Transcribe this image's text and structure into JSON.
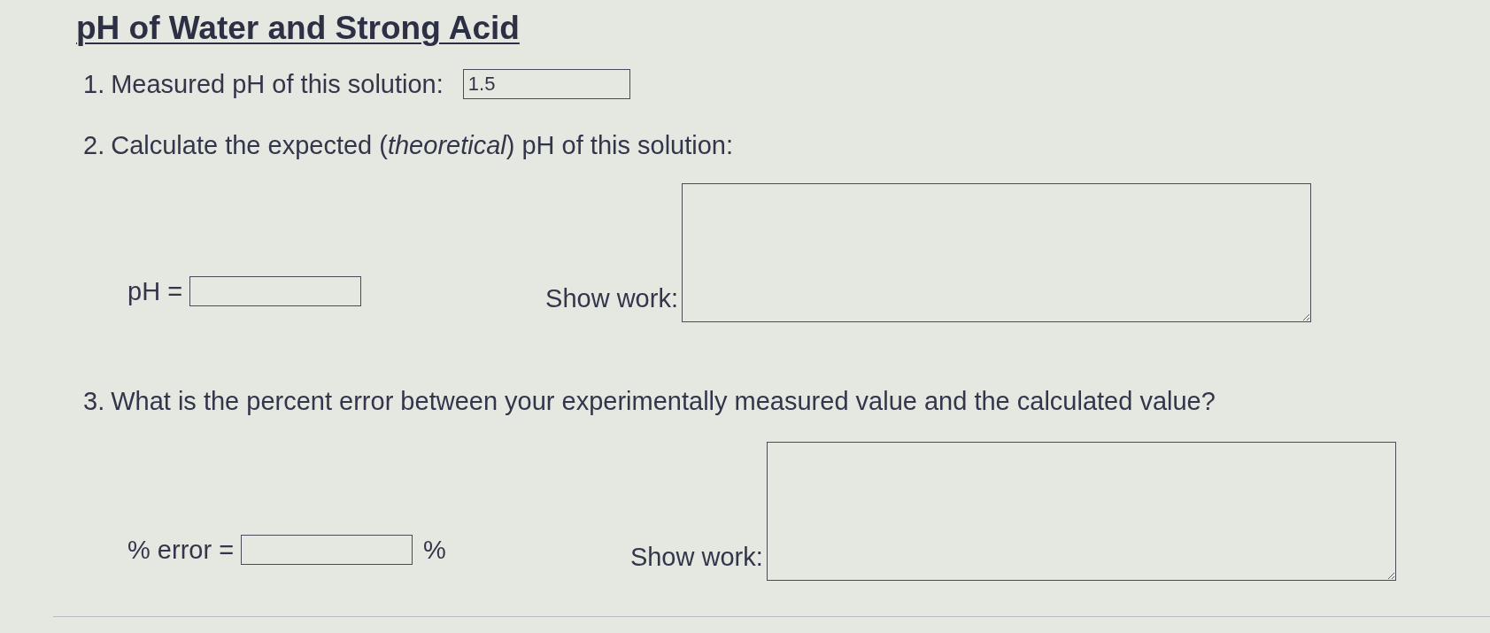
{
  "title": "pH of Water and Strong Acid",
  "questions": [
    {
      "number": "1.",
      "kind": "inline",
      "prompt": "Measured pH of this solution:",
      "answer": {
        "value": "1.5"
      }
    },
    {
      "number": "2.",
      "kind": "block",
      "prompt": "Calculate the expected (*theoretical*) pH of this solution:",
      "answer": {
        "label": "pH ="
      },
      "work": {
        "label": "Show work:"
      }
    },
    {
      "number": "3.",
      "kind": "block",
      "prompt": "What is the percent error between your experimentally measured value and the calculated value?",
      "answer": {
        "label": "% error =",
        "unit": "%"
      },
      "work": {
        "label": "Show work:"
      }
    }
  ]
}
